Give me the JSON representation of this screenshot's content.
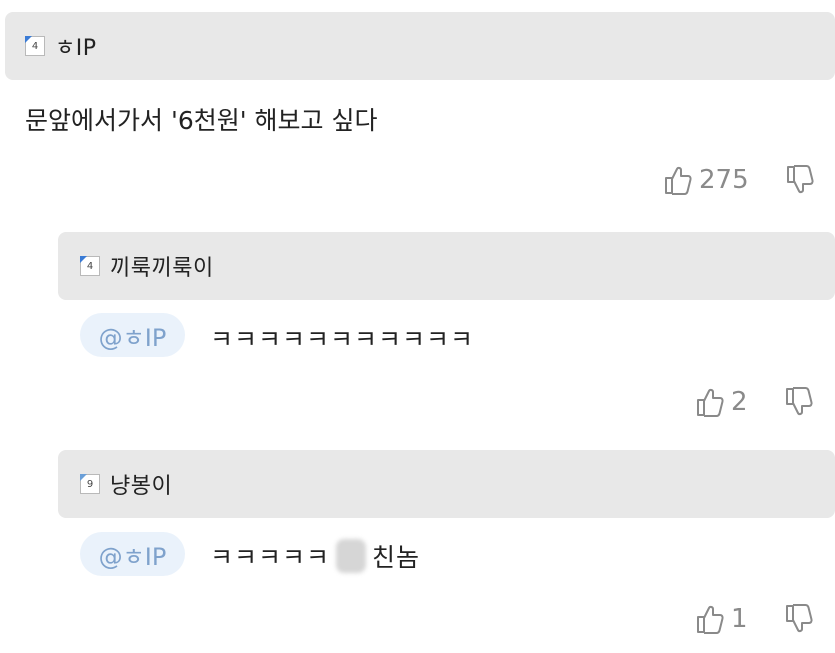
{
  "comments": [
    {
      "level": "4",
      "nickname": "ㅎIP",
      "text": "문앞에서가서 '6천원' 해보고 싶다",
      "likes": "275"
    }
  ],
  "replies": [
    {
      "level": "4",
      "nickname": "끼룩끼룩이",
      "mention": "@ㅎIP",
      "text": "ㅋㅋㅋㅋㅋㅋㅋㅋㅋㅋㅋ",
      "likes": "2"
    },
    {
      "level": "9",
      "nickname": "냥봉이",
      "mention": "@ㅎIP",
      "text_before": "ㅋㅋㅋㅋㅋ",
      "text_after": "친놈",
      "likes": "1"
    }
  ],
  "icons": {
    "like": "thumbs-up-icon",
    "dislike": "thumbs-down-icon"
  },
  "colors": {
    "header_bg": "#e8e8e8",
    "mention_bg": "#eaf2fb",
    "mention_text": "#7fa2cc",
    "badge_corner": "#3a7bd5",
    "count_text": "#8a8a8a"
  }
}
